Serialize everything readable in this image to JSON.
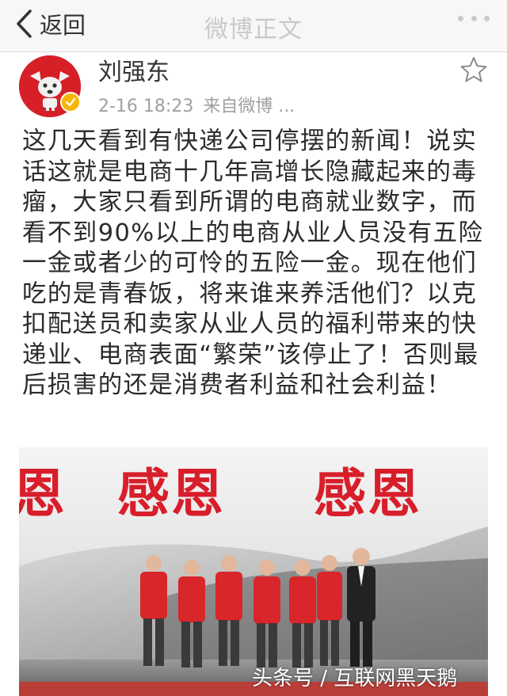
{
  "nav": {
    "back_label": "返回",
    "title": "微博正文"
  },
  "post": {
    "username": "刘强东",
    "timestamp": "2-16 18:23",
    "source": "来自微博 ...",
    "text": "这几天看到有快递公司停摆的新闻！说实话这就是电商十几年高增长隐藏起来的毒瘤，大家只看到所谓的电商就业数字，而看不到90%以上的电商从业人员没有五险一金或者少的可怜的五险一金。现在他们吃的是青春饭，将来谁来养活他们？以克扣配送员和卖家从业人员的福利带来的快递业、电商表面“繁荣”该停止了！否则最后损害的还是消费者利益和社会利益！"
  },
  "photo": {
    "banner_left_fragment": "恩",
    "banner_middle": "感恩",
    "banner_right": "感恩",
    "watermark": "头条号 / 互联网黑天鹅"
  },
  "icons": {
    "back": "chevron-left-icon",
    "more": "more-dots-icon",
    "favorite": "star-outline-icon",
    "verified": "verified-badge-icon"
  },
  "colors": {
    "accent_red": "#d81e2a",
    "verified_gold": "#f7b500",
    "title_gray": "#c9c9c9",
    "meta_gray": "#a0a0a0"
  }
}
